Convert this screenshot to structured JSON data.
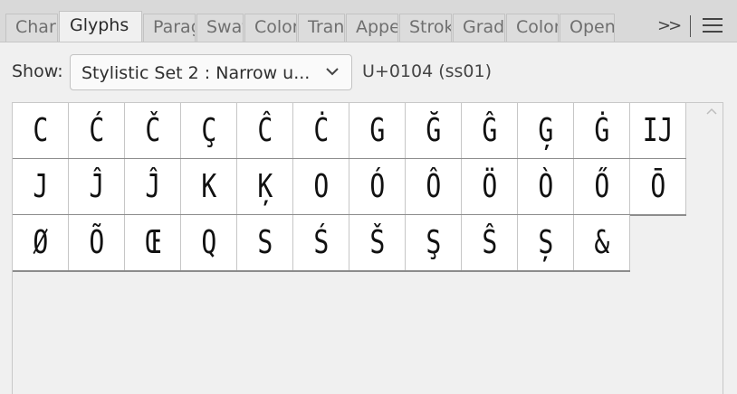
{
  "tabs": [
    {
      "label": "Character",
      "active": false
    },
    {
      "label": "Glyphs",
      "active": true
    },
    {
      "label": "Paragraph",
      "active": false
    },
    {
      "label": "Swatches",
      "active": false
    },
    {
      "label": "Color",
      "active": false
    },
    {
      "label": "Transform",
      "active": false
    },
    {
      "label": "Appearance",
      "active": false
    },
    {
      "label": "Stroke",
      "active": false
    },
    {
      "label": "Gradient",
      "active": false
    },
    {
      "label": "Color Guide",
      "active": false
    },
    {
      "label": "Opentype",
      "active": false
    }
  ],
  "toolbar": {
    "overflow_label": ">>",
    "menu_icon": "hamburger-icon"
  },
  "show": {
    "label": "Show:",
    "selected": "Stylistic Set 2 : Narrow u...",
    "unicode_readout": "U+0104 (ss01)"
  },
  "glyphs": [
    [
      "C",
      "Ć",
      "Č",
      "Ç",
      "Ĉ",
      "Ċ",
      "G",
      "Ğ",
      "Ĝ",
      "Ģ",
      "Ġ",
      "IJ"
    ],
    [
      "J",
      "Ĵ",
      "Ĵ",
      "K",
      "Ķ",
      "O",
      "Ó",
      "Ô",
      "Ö",
      "Ò",
      "Ő",
      "Ō"
    ],
    [
      "Ø",
      "Õ",
      "Œ",
      "Q",
      "S",
      "Ś",
      "Š",
      "Ş",
      "Ŝ",
      "Ș",
      "&"
    ]
  ],
  "colors": {
    "panel_bg": "#f0f0f0",
    "tab_bar": "#d9d9d9",
    "cell_bg": "#ffffff",
    "border": "#c6c6c6"
  }
}
